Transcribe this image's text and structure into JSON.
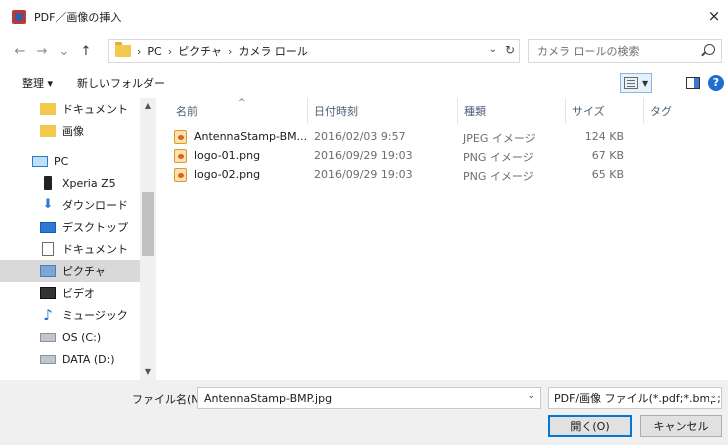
{
  "window": {
    "title": "PDF／画像の挿入",
    "close_glyph": "×"
  },
  "nav": {
    "back_glyph": "←",
    "forward_glyph": "→",
    "recent_glyph": "⌄",
    "up_glyph": "↑",
    "breadcrumb": [
      "PC",
      "ピクチャ",
      "カメラ ロール"
    ],
    "crumb_sep": "›",
    "dropdown_glyph": "⌄",
    "refresh_glyph": "↻",
    "search_placeholder": "カメラ ロールの検索"
  },
  "toolbar": {
    "organize_label": "整理 ▾",
    "new_folder_label": "新しいフォルダー",
    "view_dd_glyph": "▼",
    "help_glyph": "?"
  },
  "sidebar": {
    "items": [
      {
        "label": "ドキュメント",
        "icon": "folder-icon",
        "indent": true
      },
      {
        "label": "画像",
        "icon": "folder-icon",
        "indent": true
      },
      {
        "label": "PC",
        "icon": "pc-icon",
        "indent": false
      },
      {
        "label": "Xperia Z5",
        "icon": "phone-icon",
        "indent": true
      },
      {
        "label": "ダウンロード",
        "icon": "download-icon",
        "indent": true
      },
      {
        "label": "デスクトップ",
        "icon": "desktop-icon",
        "indent": true
      },
      {
        "label": "ドキュメント",
        "icon": "document-icon",
        "indent": true
      },
      {
        "label": "ピクチャ",
        "icon": "pictures-icon",
        "indent": true,
        "selected": true
      },
      {
        "label": "ビデオ",
        "icon": "video-icon",
        "indent": true
      },
      {
        "label": "ミュージック",
        "icon": "music-icon",
        "indent": true
      },
      {
        "label": "OS (C:)",
        "icon": "drive-icon",
        "indent": true
      },
      {
        "label": "DATA (D:)",
        "icon": "drive-icon",
        "indent": true
      }
    ],
    "scroll_up_glyph": "▲",
    "scroll_down_glyph": "▼"
  },
  "columns": {
    "name": "名前",
    "date": "日付時刻",
    "type": "種類",
    "size": "サイズ",
    "tag": "タグ",
    "sort_glyph": "^"
  },
  "files": [
    {
      "name": "AntennaStamp-BM...",
      "date": "2016/02/03 9:57",
      "type": "JPEG イメージ",
      "size": "124 KB"
    },
    {
      "name": "logo-01.png",
      "date": "2016/09/29 19:03",
      "type": "PNG イメージ",
      "size": "67 KB"
    },
    {
      "name": "logo-02.png",
      "date": "2016/09/29 19:03",
      "type": "PNG イメージ",
      "size": "65 KB"
    }
  ],
  "footer": {
    "filename_label": "ファイル名(N):",
    "filename_value": "AntennaStamp-BMP.jpg",
    "filetype_value": "PDF/画像 ファイル(*.pdf;*.bmp;*.",
    "dd_glyph": "⌄",
    "open_label": "開く(O)",
    "cancel_label": "キャンセル"
  }
}
